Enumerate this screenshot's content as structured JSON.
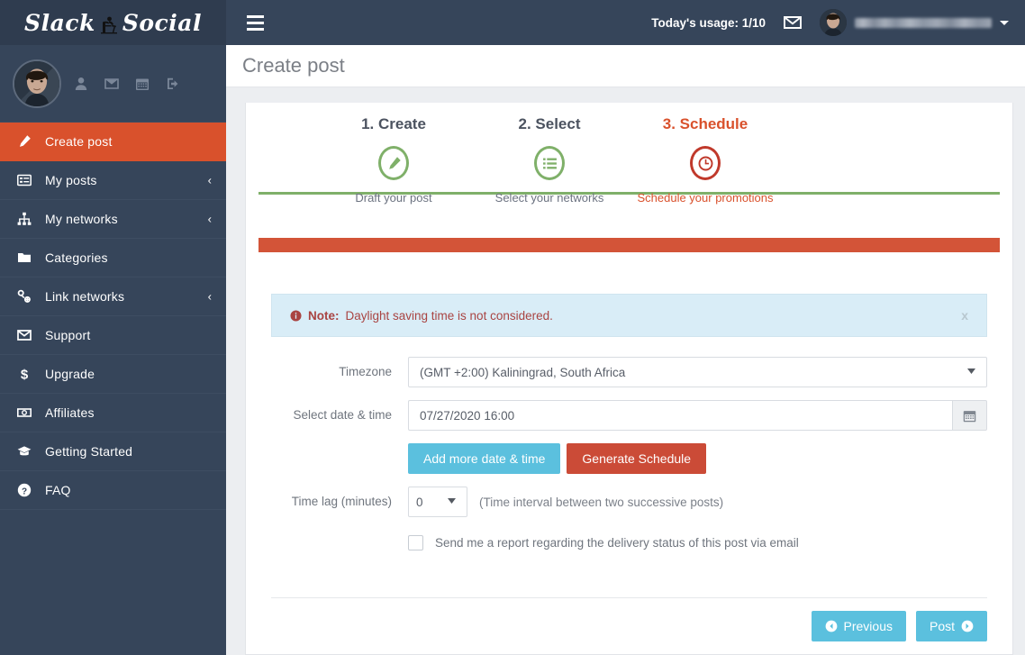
{
  "brand": {
    "name_part1": "Slack",
    "name_part2": "Social",
    "chair_icon": "person-in-chair-icon"
  },
  "sidebar": {
    "profile_icons": [
      {
        "name": "user-icon"
      },
      {
        "name": "envelope-icon"
      },
      {
        "name": "calendar-icon"
      },
      {
        "name": "sign-out-icon"
      }
    ],
    "items": [
      {
        "label": "Create post",
        "icon": "pencil-icon",
        "active": true,
        "caret": ""
      },
      {
        "label": "My posts",
        "icon": "list-alt-icon",
        "active": false,
        "caret": "‹"
      },
      {
        "label": "My networks",
        "icon": "sitemap-icon",
        "active": false,
        "caret": "‹"
      },
      {
        "label": "Categories",
        "icon": "folder-icon",
        "active": false,
        "caret": ""
      },
      {
        "label": "Link networks",
        "icon": "link-icon",
        "active": false,
        "caret": "‹"
      },
      {
        "label": "Support",
        "icon": "envelope-icon",
        "active": false,
        "caret": ""
      },
      {
        "label": "Upgrade",
        "icon": "dollar-icon",
        "active": false,
        "caret": ""
      },
      {
        "label": "Affiliates",
        "icon": "money-icon",
        "active": false,
        "caret": ""
      },
      {
        "label": "Getting Started",
        "icon": "graduation-cap-icon",
        "active": false,
        "caret": ""
      },
      {
        "label": "FAQ",
        "icon": "question-circle-icon",
        "active": false,
        "caret": ""
      }
    ]
  },
  "topbar": {
    "menu_toggle": "hamburger-icon",
    "usage_label": "Today's usage: 1/10",
    "mail_icon": "envelope-icon",
    "username": "",
    "caret": "chevron-down-icon"
  },
  "page": {
    "title": "Create post"
  },
  "wizard": {
    "steps": [
      {
        "title": "1. Create",
        "sub": "Draft your post",
        "icon": "pencil-icon",
        "state": "done"
      },
      {
        "title": "2. Select",
        "sub": "Select your networks",
        "icon": "list-icon",
        "state": "done"
      },
      {
        "title": "3. Schedule",
        "sub": "Schedule your promotions",
        "icon": "clock-icon",
        "state": "current"
      }
    ]
  },
  "progress": {
    "percent": 100,
    "color": "#d35438"
  },
  "alert": {
    "icon": "info-circle-icon",
    "strong": "Note:",
    "text": " Daylight saving time is not considered.",
    "close_label": "x"
  },
  "form": {
    "timezone": {
      "label": "Timezone",
      "value": "(GMT +2:00) Kaliningrad, South Africa"
    },
    "datetime": {
      "label": "Select date & time",
      "value": "07/27/2020 16:00",
      "calendar_icon": "calendar-icon"
    },
    "buttons": {
      "add_more": "Add more date & time",
      "generate": "Generate Schedule"
    },
    "timelag": {
      "label": "Time lag (minutes)",
      "value": "0",
      "hint": "(Time interval between two successive posts)"
    },
    "report_checkbox": {
      "label": "Send me a report regarding the delivery status of this post via email",
      "checked": false
    }
  },
  "footer": {
    "previous": "Previous",
    "post": "Post",
    "prev_icon": "chevron-left-circle-icon",
    "post_icon": "chevron-right-circle-icon"
  }
}
